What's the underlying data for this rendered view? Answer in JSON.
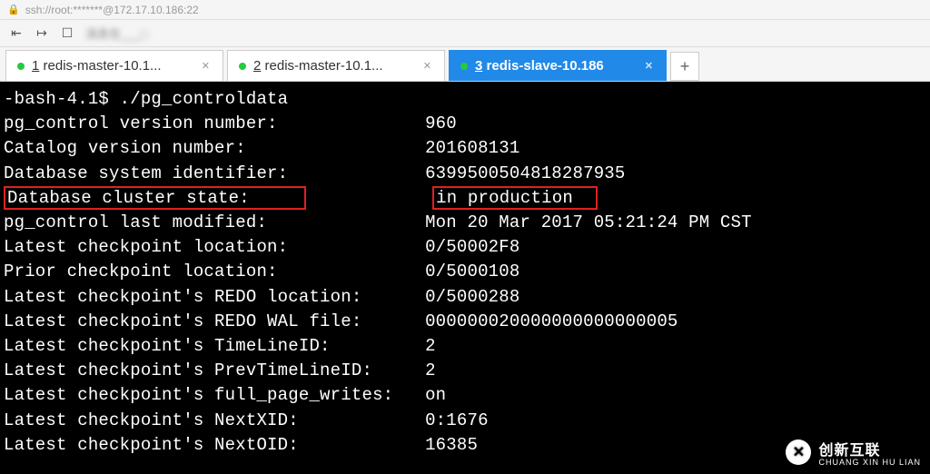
{
  "address": "ssh://root:*******@172.17.10.186:22",
  "blurred_text": "消息在___□",
  "tabs": [
    {
      "num": "1",
      "label": "redis-master-10.1..."
    },
    {
      "num": "2",
      "label": "redis-master-10.1..."
    },
    {
      "num": "3",
      "label": "redis-slave-10.186"
    }
  ],
  "terminal": {
    "prompt": "-bash-4.1$ ",
    "command": "./pg_controldata",
    "rows": [
      {
        "k": "pg_control version number:",
        "v": "960"
      },
      {
        "k": "Catalog version number:",
        "v": "201608131"
      },
      {
        "k": "Database system identifier:",
        "v": "6399500504818287935"
      },
      {
        "k": "Database cluster state:",
        "v": "in production"
      },
      {
        "k": "pg_control last modified:",
        "v": "Mon 20 Mar 2017 05:21:24 PM CST"
      },
      {
        "k": "Latest checkpoint location:",
        "v": "0/50002F8"
      },
      {
        "k": "Prior checkpoint location:",
        "v": "0/5000108"
      },
      {
        "k": "Latest checkpoint's REDO location:",
        "v": "0/5000288"
      },
      {
        "k": "Latest checkpoint's REDO WAL file:",
        "v": "000000020000000000000005"
      },
      {
        "k": "Latest checkpoint's TimeLineID:",
        "v": "2"
      },
      {
        "k": "Latest checkpoint's PrevTimeLineID:",
        "v": "2"
      },
      {
        "k": "Latest checkpoint's full_page_writes:",
        "v": "on"
      },
      {
        "k": "Latest checkpoint's NextXID:",
        "v": "0:1676"
      },
      {
        "k": "Latest checkpoint's NextOID:",
        "v": "16385"
      }
    ]
  },
  "watermark": {
    "cn": "创新互联",
    "en": "CHUANG XIN HU LIAN"
  }
}
